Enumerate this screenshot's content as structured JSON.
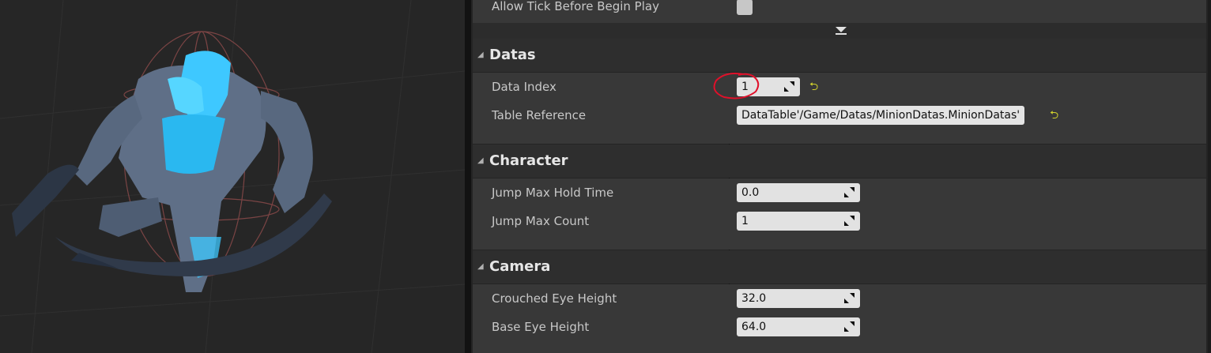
{
  "details": {
    "top_property": {
      "label": "Allow Tick Before Begin Play",
      "checked": false
    },
    "categories": [
      {
        "title": "Datas",
        "properties": [
          {
            "label": "Data Index",
            "value": "1",
            "reset_icon": "reset-to-default-icon"
          },
          {
            "label": "Table Reference",
            "value": "DataTable'/Game/Datas/MinionDatas.MinionDatas'",
            "reset_icon": "reset-to-default-icon"
          }
        ]
      },
      {
        "title": "Character",
        "properties": [
          {
            "label": "Jump Max Hold Time",
            "value": "0.0"
          },
          {
            "label": "Jump Max Count",
            "value": "1"
          }
        ]
      },
      {
        "title": "Camera",
        "properties": [
          {
            "label": "Crouched Eye Height",
            "value": "32.0"
          },
          {
            "label": "Base Eye Height",
            "value": "64.0"
          }
        ]
      }
    ]
  },
  "colors": {
    "panel_bg": "#242424",
    "row_bg": "#383838",
    "category_bg": "#2e2e2e",
    "reset_arrow": "#d2d22c",
    "annotation": "#e0102a",
    "accent_glow": "#2ec4ff"
  },
  "icons": [
    "collapse-arrow-icon",
    "expand-advanced-icon",
    "spin-arrows-icon",
    "reset-to-default-icon"
  ]
}
